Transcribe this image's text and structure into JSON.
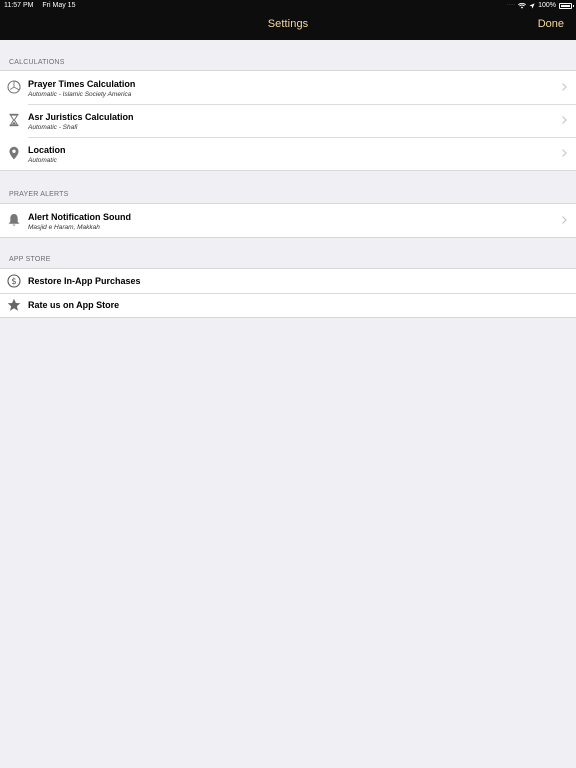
{
  "status_bar": {
    "time": "11:57 PM",
    "date": "Fri May 15",
    "battery": "100%"
  },
  "nav": {
    "title": "Settings",
    "done_label": "Done",
    "accent_color": "#f3d9a0"
  },
  "sections": {
    "calculations": {
      "header": "CALCULATIONS",
      "rows": [
        {
          "title": "Prayer Times Calculation",
          "subtitle": "Automatic - Islamic Society America",
          "icon": "clock-icon"
        },
        {
          "title": "Asr Juristics Calculation",
          "subtitle": "Automatic - Shafi",
          "icon": "hourglass-icon"
        },
        {
          "title": "Location",
          "subtitle": "Automatic",
          "icon": "location-pin-icon"
        }
      ]
    },
    "prayer_alerts": {
      "header": "PRAYER ALERTS",
      "rows": [
        {
          "title": "Alert Notification Sound",
          "subtitle": "Masjid e Haram, Makkah",
          "icon": "bell-icon"
        }
      ]
    },
    "app_store": {
      "header": "APP STORE",
      "rows": [
        {
          "title": "Restore In-App Purchases",
          "icon": "dollar-circle-icon"
        },
        {
          "title": "Rate us on App Store",
          "icon": "star-icon"
        }
      ]
    }
  }
}
